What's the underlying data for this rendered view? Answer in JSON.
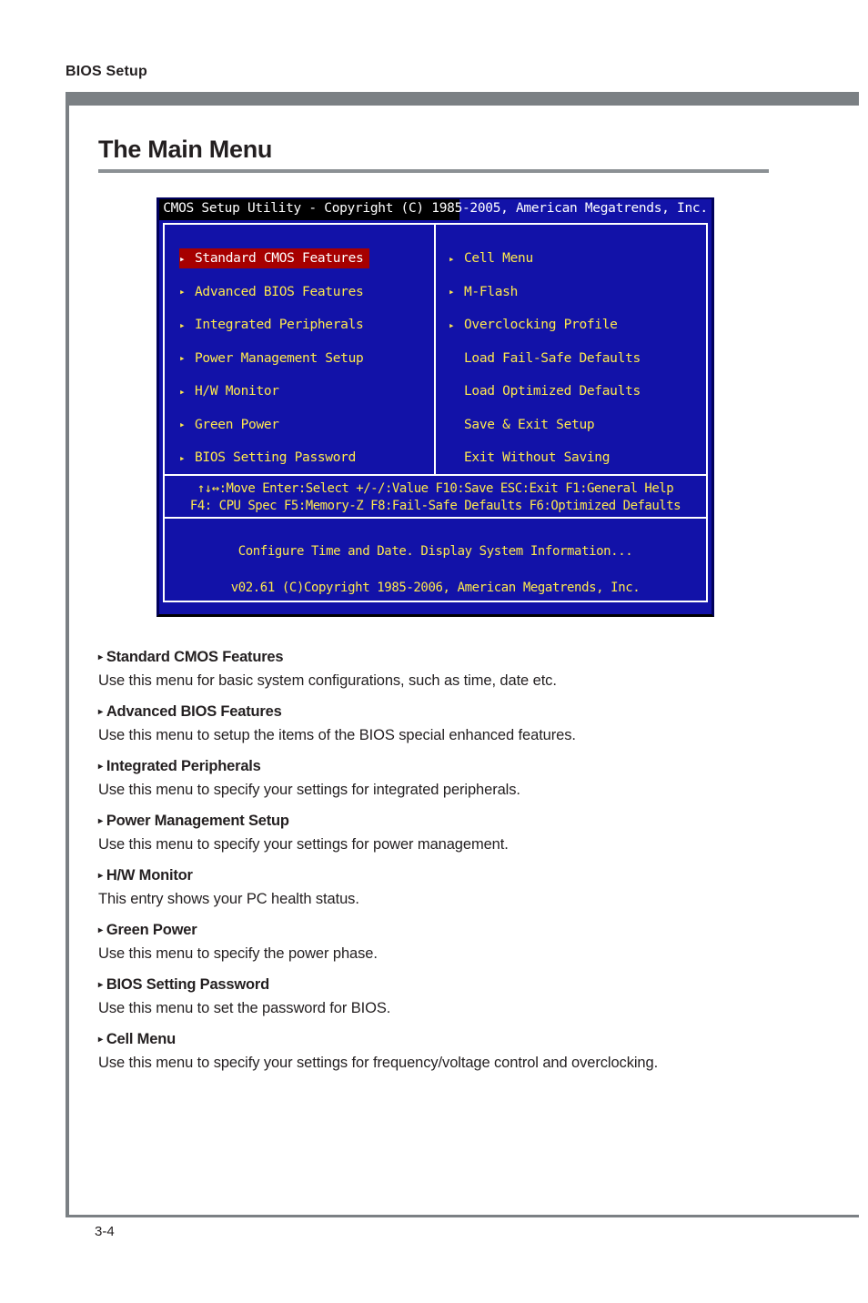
{
  "document": {
    "header": "BIOS Setup",
    "page_number": "3-4",
    "section_title": "The Main Menu"
  },
  "bios": {
    "titlebar": "CMOS Setup Utility - Copyright (C) 1985-2005, American Megatrends, Inc.",
    "left_column": [
      {
        "label": "Standard CMOS Features",
        "bullet": "▸",
        "selected": true
      },
      {
        "label": "Advanced BIOS Features",
        "bullet": "▸",
        "selected": false
      },
      {
        "label": "Integrated Peripherals",
        "bullet": "▸",
        "selected": false
      },
      {
        "label": "Power Management Setup",
        "bullet": "▸",
        "selected": false
      },
      {
        "label": "H/W Monitor",
        "bullet": "▸",
        "selected": false
      },
      {
        "label": "Green Power",
        "bullet": "▸",
        "selected": false
      },
      {
        "label": "BIOS Setting Password",
        "bullet": "▸",
        "selected": false
      }
    ],
    "right_column": [
      {
        "label": "Cell Menu",
        "bullet": "▸",
        "selected": false
      },
      {
        "label": "M-Flash",
        "bullet": "▸",
        "selected": false
      },
      {
        "label": "Overclocking Profile",
        "bullet": "▸",
        "selected": false
      },
      {
        "label": "Load Fail-Safe Defaults",
        "bullet": "",
        "selected": false
      },
      {
        "label": "Load Optimized Defaults",
        "bullet": "",
        "selected": false
      },
      {
        "label": "Save & Exit Setup",
        "bullet": "",
        "selected": false
      },
      {
        "label": "Exit Without Saving",
        "bullet": "",
        "selected": false
      }
    ],
    "help_line_1": "↑↓↔:Move  Enter:Select  +/-/:Value  F10:Save  ESC:Exit  F1:General Help",
    "help_line_2": "F4: CPU Spec    F5:Memory-Z    F8:Fail-Safe Defaults    F6:Optimized Defaults",
    "info_line_1": "Configure Time and Date.  Display System Information...",
    "info_line_2": "v02.61 (C)Copyright 1985-2006, American Megatrends, Inc.",
    "colors": {
      "background": "#1212a8",
      "text": "#ffe94d",
      "highlight_bg": "#a60000",
      "highlight_text": "#ffffff",
      "titlebar_bg": "#000000",
      "border": "#ffffff"
    }
  },
  "descriptions": [
    {
      "bullet": "▸",
      "title": "Standard CMOS Features",
      "text": "Use this menu for basic system configurations, such as time, date etc."
    },
    {
      "bullet": "▸",
      "title": "Advanced BIOS Features",
      "text": "Use this menu to setup the items of the BIOS special enhanced features."
    },
    {
      "bullet": "▸",
      "title": "Integrated Peripherals",
      "text": "Use this menu to specify your settings for integrated peripherals."
    },
    {
      "bullet": "▸",
      "title": "Power Management Setup",
      "text": "Use this menu to specify your settings for power management."
    },
    {
      "bullet": "▸",
      "title": "H/W Monitor",
      "text": "This entry shows your PC health status."
    },
    {
      "bullet": "▸",
      "title": "Green Power",
      "text": "Use this menu to specify the power phase."
    },
    {
      "bullet": "▸",
      "title": "BIOS Setting Password",
      "text": "Use this menu to set the password for BIOS."
    },
    {
      "bullet": "▸",
      "title": "Cell Menu",
      "text": "Use this menu to specify your settings for frequency/voltage control and overclocking."
    }
  ]
}
